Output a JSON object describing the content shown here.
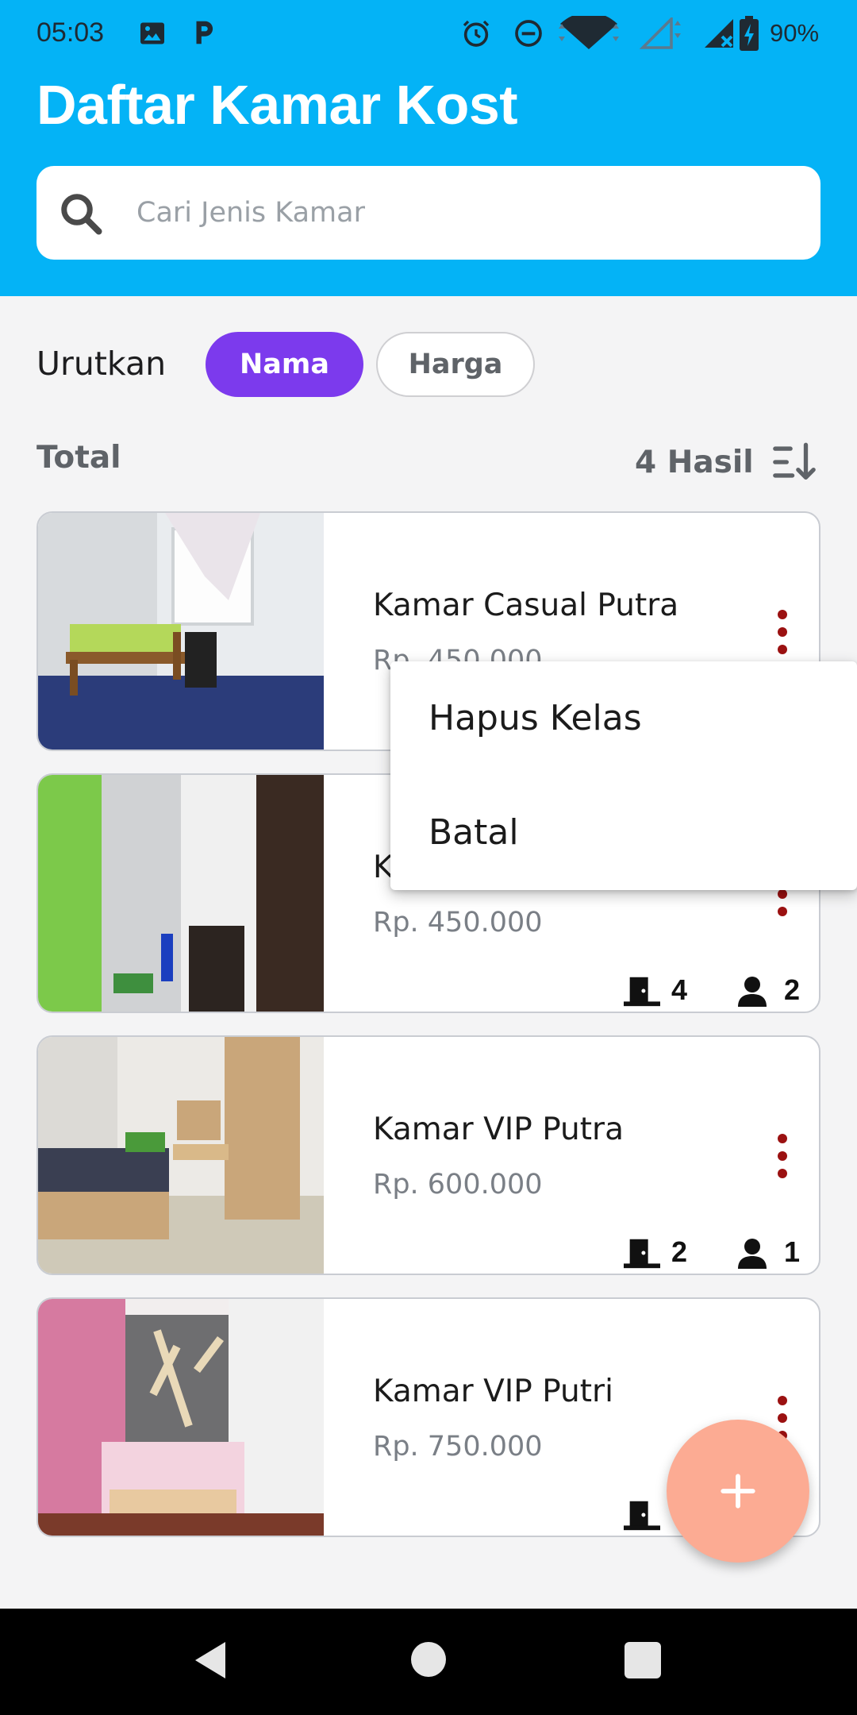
{
  "status": {
    "time": "05:03",
    "battery": "90%"
  },
  "app": {
    "title": "Daftar Kamar Kost"
  },
  "search": {
    "placeholder": "Cari Jenis Kamar",
    "value": ""
  },
  "sort": {
    "label": "Urutkan",
    "options": [
      "Nama",
      "Harga"
    ],
    "selected": "Nama"
  },
  "summary": {
    "total_label": "Total",
    "result_count": "4 Hasil"
  },
  "rooms": [
    {
      "name": "Kamar Casual Putra",
      "price": "Rp. 450.000",
      "doors": "",
      "persons": ""
    },
    {
      "name": "K",
      "price": "Rp. 450.000",
      "doors": "4",
      "persons": "2"
    },
    {
      "name": "Kamar VIP Putra",
      "price": "Rp. 600.000",
      "doors": "2",
      "persons": "1"
    },
    {
      "name": "Kamar VIP Putri",
      "price": "Rp. 750.000",
      "doors": "",
      "persons": ""
    }
  ],
  "popup": {
    "items": [
      "Hapus Kelas",
      "Batal"
    ]
  },
  "fab": {
    "icon": "plus-icon"
  },
  "colors": {
    "header": "#04b3f6",
    "chip_active": "#7c3aed",
    "kebab": "#9b1111",
    "fab": "#fcab93"
  },
  "icons": {
    "status_left": [
      "image-icon",
      "p-icon"
    ],
    "status_right": [
      "alarm-icon",
      "dnd-icon",
      "wifi-icon",
      "signal-icon",
      "signal-x-icon",
      "battery-charging-icon"
    ],
    "nav": [
      "back-icon",
      "home-icon",
      "recents-icon"
    ]
  }
}
